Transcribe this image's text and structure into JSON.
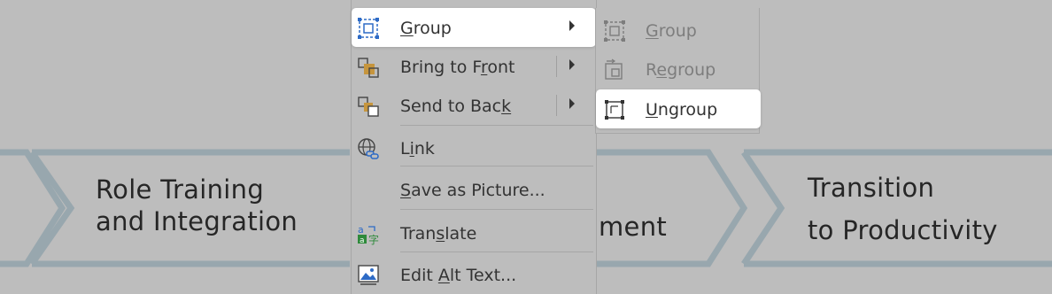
{
  "slide": {
    "step_role_line1": "Role Training",
    "step_role_line2": "and Integration",
    "step_middle_fragment": "ment",
    "step_transition_line1": "Transition",
    "step_transition_line2": "to Productivity"
  },
  "context_menu": {
    "items": [
      {
        "pre": "",
        "key": "G",
        "post": "roup",
        "icon": "group-icon",
        "submenu": true,
        "highlighted": true
      },
      {
        "pre": "Bring to F",
        "key": "r",
        "post": "ont",
        "icon": "bring-to-front-icon",
        "submenu": true
      },
      {
        "pre": "Send to Bac",
        "key": "k",
        "post": "",
        "icon": "send-to-back-icon",
        "submenu": true
      },
      {
        "pre": "L",
        "key": "i",
        "post": "nk",
        "icon": "link-globe-icon"
      },
      {
        "pre": "",
        "key": "S",
        "post": "ave as Picture...",
        "icon": ""
      },
      {
        "pre": "Tran",
        "key": "s",
        "post": "late",
        "icon": "translate-icon"
      },
      {
        "pre": "Edit ",
        "key": "A",
        "post": "lt Text...",
        "icon": "alt-text-icon"
      }
    ]
  },
  "submenu": {
    "items": [
      {
        "pre": "",
        "key": "G",
        "post": "roup",
        "icon": "group-icon",
        "disabled": true
      },
      {
        "pre": "R",
        "key": "e",
        "post": "group",
        "icon": "regroup-icon",
        "disabled": true
      },
      {
        "pre": "",
        "key": "U",
        "post": "ngroup",
        "icon": "ungroup-icon",
        "highlighted": true
      }
    ]
  },
  "colors": {
    "overlay_gray": "#bdbdbd",
    "chevron_outline": "#8a96a0",
    "highlight": "#ffffff"
  }
}
